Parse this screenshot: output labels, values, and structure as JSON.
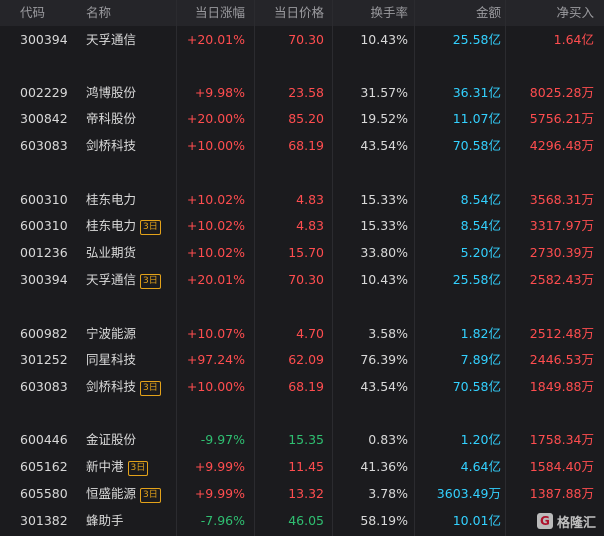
{
  "columns": {
    "code": "代码",
    "name": "名称",
    "change": "当日涨幅",
    "price": "当日价格",
    "turnover": "换手率",
    "amount": "金额",
    "net_buy": "净买入"
  },
  "rows": [
    {
      "code": "300394",
      "name": "天孚通信",
      "tag": "",
      "change": "+20.01%",
      "price": "70.30",
      "turnover": "10.43%",
      "amount": "25.58亿",
      "net_buy": "1.64亿",
      "dir": "up"
    },
    {
      "code": "002229",
      "name": "鸿博股份",
      "tag": "",
      "change": "+9.98%",
      "price": "23.58",
      "turnover": "31.57%",
      "amount": "36.31亿",
      "net_buy": "8025.28万",
      "dir": "up"
    },
    {
      "code": "300842",
      "name": "帝科股份",
      "tag": "",
      "change": "+20.00%",
      "price": "85.20",
      "turnover": "19.52%",
      "amount": "11.07亿",
      "net_buy": "5756.21万",
      "dir": "up"
    },
    {
      "code": "603083",
      "name": "剑桥科技",
      "tag": "",
      "change": "+10.00%",
      "price": "68.19",
      "turnover": "43.54%",
      "amount": "70.58亿",
      "net_buy": "4296.48万",
      "dir": "up"
    },
    {
      "code": "600310",
      "name": "桂东电力",
      "tag": "",
      "change": "+10.02%",
      "price": "4.83",
      "turnover": "15.33%",
      "amount": "8.54亿",
      "net_buy": "3568.31万",
      "dir": "up"
    },
    {
      "code": "600310",
      "name": "桂东电力",
      "tag": "3日",
      "change": "+10.02%",
      "price": "4.83",
      "turnover": "15.33%",
      "amount": "8.54亿",
      "net_buy": "3317.97万",
      "dir": "up"
    },
    {
      "code": "001236",
      "name": "弘业期货",
      "tag": "",
      "change": "+10.02%",
      "price": "15.70",
      "turnover": "33.80%",
      "amount": "5.20亿",
      "net_buy": "2730.39万",
      "dir": "up"
    },
    {
      "code": "300394",
      "name": "天孚通信",
      "tag": "3日",
      "change": "+20.01%",
      "price": "70.30",
      "turnover": "10.43%",
      "amount": "25.58亿",
      "net_buy": "2582.43万",
      "dir": "up"
    },
    {
      "code": "600982",
      "name": "宁波能源",
      "tag": "",
      "change": "+10.07%",
      "price": "4.70",
      "turnover": "3.58%",
      "amount": "1.82亿",
      "net_buy": "2512.48万",
      "dir": "up"
    },
    {
      "code": "301252",
      "name": "同星科技",
      "tag": "",
      "change": "+97.24%",
      "price": "62.09",
      "turnover": "76.39%",
      "amount": "7.89亿",
      "net_buy": "2446.53万",
      "dir": "up"
    },
    {
      "code": "603083",
      "name": "剑桥科技",
      "tag": "3日",
      "change": "+10.00%",
      "price": "68.19",
      "turnover": "43.54%",
      "amount": "70.58亿",
      "net_buy": "1849.88万",
      "dir": "up"
    },
    {
      "code": "600446",
      "name": "金证股份",
      "tag": "",
      "change": "-9.97%",
      "price": "15.35",
      "turnover": "0.83%",
      "amount": "1.20亿",
      "net_buy": "1758.34万",
      "dir": "down"
    },
    {
      "code": "605162",
      "name": "新中港",
      "tag": "3日",
      "change": "+9.99%",
      "price": "11.45",
      "turnover": "41.36%",
      "amount": "4.64亿",
      "net_buy": "1584.40万",
      "dir": "up"
    },
    {
      "code": "605580",
      "name": "恒盛能源",
      "tag": "3日",
      "change": "+9.99%",
      "price": "13.32",
      "turnover": "3.78%",
      "amount": "3603.49万",
      "net_buy": "1387.88万",
      "dir": "up"
    },
    {
      "code": "301382",
      "name": "蜂助手",
      "tag": "",
      "change": "-7.96%",
      "price": "46.05",
      "turnover": "58.19%",
      "amount": "10.01亿",
      "net_buy": "",
      "dir": "down"
    }
  ],
  "watermark": {
    "text": "格隆汇",
    "logo": "G"
  },
  "colors": {
    "up": "#ff4d4f",
    "down": "#2fbf71",
    "amount": "#33d1ff",
    "background": "#1b1b1e"
  }
}
